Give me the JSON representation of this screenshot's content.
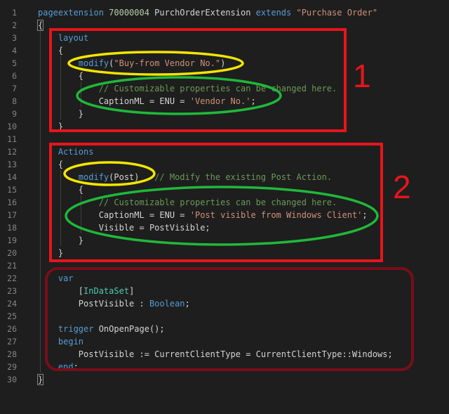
{
  "editor": {
    "line_numbers": [
      "1",
      "2",
      "3",
      "4",
      "5",
      "6",
      "7",
      "8",
      "9",
      "10",
      "11",
      "12",
      "13",
      "14",
      "15",
      "16",
      "17",
      "18",
      "19",
      "20",
      "21",
      "22",
      "23",
      "24",
      "25",
      "26",
      "27",
      "28",
      "29",
      "30"
    ],
    "lines": [
      "pageextension 70000004 PurchOrderExtension extends \"Purchase Order\"",
      "{",
      "    layout",
      "    {",
      "        modify(\"Buy-from Vendor No.\")",
      "        {",
      "            // Customizable properties can be changed here.",
      "            CaptionML = ENU = 'Vendor No.';",
      "        }",
      "    }",
      "",
      "    Actions",
      "    {",
      "        modify(Post)   // Modify the existing Post Action.",
      "        {",
      "            // Customizable properties can be changed here.",
      "            CaptionML = ENU = 'Post visible from Windows Client';",
      "            Visible = PostVisible;",
      "        }",
      "    }",
      "",
      "    var",
      "        [InDataSet]",
      "        PostVisible : Boolean;",
      "",
      "    trigger OnOpenPage();",
      "    begin",
      "        PostVisible := CurrentClientType = CurrentClientType::Windows;",
      "    end;",
      "}"
    ]
  },
  "annotations": {
    "label_1": "1",
    "label_2": "2"
  },
  "colors": {
    "background": "#1e1e1e",
    "keyword": "#569cd6",
    "string": "#ce9178",
    "comment": "#6a9955",
    "box_red": "#e8141b",
    "box_dark_red": "#7a0d1a",
    "oval_yellow": "#f2e600",
    "oval_green": "#1fb83a"
  }
}
